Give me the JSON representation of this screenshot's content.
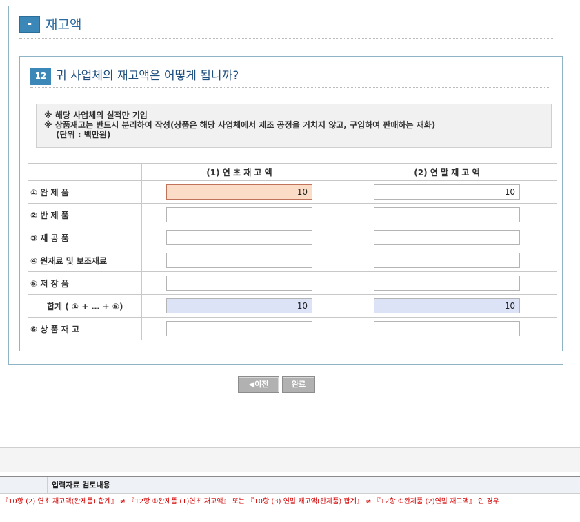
{
  "section": {
    "toggle_label": "-",
    "title": "재고액"
  },
  "question": {
    "number": "12",
    "text": "귀 사업체의 재고액은 어떻게 됩니까?"
  },
  "notice": {
    "lines": [
      "※ 해당 사업체의 실적만 기입",
      "※ 상품재고는 반드시 분리하여 작성(상품은 해당 사업체에서 제조 공정을 거치지 않고, 구입하여 판매하는 재화)",
      "(단위 : 백만원)"
    ]
  },
  "table": {
    "headers": [
      "",
      "(1) 연 초 재 고 액",
      "(2) 연 말 재 고 액"
    ],
    "rows": [
      {
        "label": "① 완 제 품",
        "start": "10",
        "end": "10"
      },
      {
        "label": "② 반 제 품",
        "start": "",
        "end": ""
      },
      {
        "label": "③ 재 공 품",
        "start": "",
        "end": ""
      },
      {
        "label": "④ 원재료 및 보조재료",
        "start": "",
        "end": ""
      },
      {
        "label": "⑤ 저 장 품",
        "start": "",
        "end": ""
      },
      {
        "label": "합계 ( ① + … + ⑤)",
        "start": "10",
        "end": "10"
      },
      {
        "label": "⑥ 상 품 재 고",
        "start": "",
        "end": ""
      }
    ]
  },
  "buttons": {
    "prev": "◀이전",
    "done": "완료"
  },
  "review": {
    "title": "입력자료 검토내용",
    "message": "『10항 (2) 연초 재고액(완제품) 합계』 ≠ 『12항 ①완제품 (1)연초 재고액』 또는 『10항 (3) 연말 재고액(완제품) 합계』 ≠ 『12항 ①완제품 (2)연말 재고액』 인 경우"
  },
  "colors": {
    "accent": "#3b88b8",
    "active_input": "#fbdcc6",
    "sum_input": "#dce3f7",
    "error_text": "#d10000"
  }
}
